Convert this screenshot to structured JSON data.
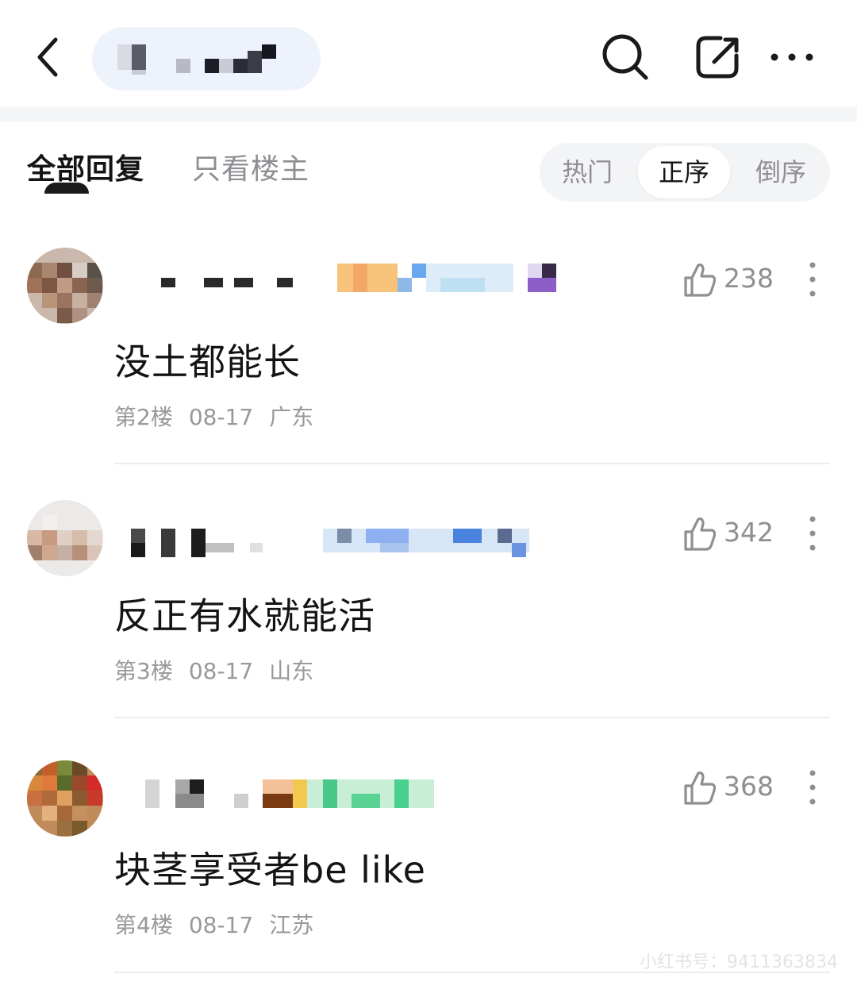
{
  "topbar": {
    "icons": [
      "back-arrow-icon",
      "search-icon",
      "share-icon",
      "more-dots-icon"
    ]
  },
  "tabs": {
    "all_replies": "全部回复",
    "op_only": "只看楼主"
  },
  "sort": {
    "hot": "热门",
    "asc": "正序",
    "desc": "倒序",
    "selected": "正序"
  },
  "posts": [
    {
      "likes": "238",
      "content": "没土都能长",
      "floor": "第2楼",
      "date": "08-17",
      "location": "广东"
    },
    {
      "likes": "342",
      "content": "反正有水就能活",
      "floor": "第3楼",
      "date": "08-17",
      "location": "山东"
    },
    {
      "likes": "368",
      "content": "块茎享受者be like",
      "floor": "第4楼",
      "date": "08-17",
      "location": "江苏"
    }
  ],
  "watermark": "小红书号：9411363834",
  "colors": {
    "text_primary": "#141414",
    "text_secondary": "#8e8e93",
    "divider": "#ededed",
    "pill_bg": "#f3f4f6"
  }
}
